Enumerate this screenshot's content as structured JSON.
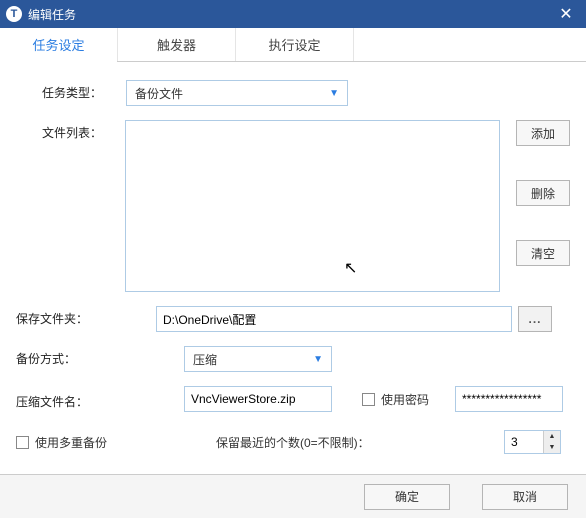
{
  "window": {
    "title": "编辑任务"
  },
  "tabs": {
    "t0": "任务设定",
    "t1": "触发器",
    "t2": "执行设定"
  },
  "labels": {
    "task_type": "任务类型：",
    "file_list": "文件列表：",
    "save_folder": "保存文件夹：",
    "backup_mode": "备份方式：",
    "zip_name": "压缩文件名：",
    "use_password": "使用密码",
    "multi_backup": "使用多重备份",
    "keep_recent": "保留最近的个数(0=不限制)："
  },
  "values": {
    "task_type": "备份文件",
    "save_folder": "D:\\OneDrive\\配置",
    "backup_mode": "压缩",
    "zip_name": "VncViewerStore.zip",
    "password": "*****************",
    "keep_recent": "3"
  },
  "buttons": {
    "add": "添加",
    "delete": "删除",
    "clear": "清空",
    "browse": "...",
    "ok": "确定",
    "cancel": "取消"
  }
}
